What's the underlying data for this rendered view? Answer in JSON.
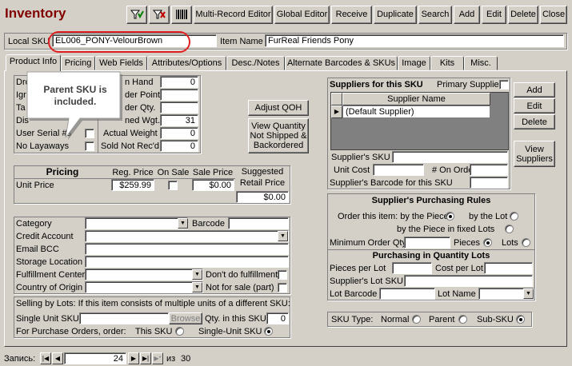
{
  "window": {
    "title": "Inventory"
  },
  "toolbar": {
    "multi_record_editor": "Multi-Record Editor",
    "global_editor": "Global Editor",
    "receive": "Receive",
    "duplicate": "Duplicate",
    "search": "Search",
    "add": "Add",
    "edit": "Edit",
    "delete": "Delete",
    "close": "Close"
  },
  "header": {
    "local_sku_label": "Local SKU",
    "local_sku": "EL006_PONY-VelourBrown",
    "item_name_label": "Item Name",
    "item_name": "FurReal Friends Pony"
  },
  "tabs": [
    "Product Info",
    "Pricing",
    "Web Fields",
    "Attributes/Options",
    "Desc./Notes",
    "Alternate Barcodes & SKUs",
    "Image",
    "Kits",
    "Misc."
  ],
  "callout": {
    "text": "Parent SKU is included."
  },
  "product": {
    "drop_label": "Dro",
    "ign_label": "Igr",
    "tax_label": "Ta",
    "dis_label": "Dis",
    "user_serial_label": "User Serial #s",
    "no_layaways_label": "No Layaways",
    "on_hand_label": "n Hand",
    "on_hand": "0",
    "reorder_point_label": "der Point",
    "reorder_qty_label": "der Qty.",
    "weight_label": "ned Wgt.",
    "weight": "31",
    "actual_weight_label": "Actual Weight",
    "actual_weight": "0",
    "sold_not_recd_label": "Sold Not Rec'd",
    "sold_not_recd": "0",
    "adjust_qoh": "Adjust QOH",
    "view_qty": "View Quantity Not Shipped & Backordered"
  },
  "pricing": {
    "header": "Pricing",
    "reg_price_label": "Reg. Price",
    "on_sale_label": "On Sale",
    "sale_price_label": "Sale Price",
    "suggested_label": "Suggested Retail Price",
    "unit_price_label": "Unit Price",
    "reg_price": "$259.99",
    "sale_price": "$0.00",
    "suggested": "$0.00"
  },
  "details": {
    "category_label": "Category",
    "barcode_label": "Barcode",
    "credit_account_label": "Credit Account",
    "email_bcc_label": "Email BCC",
    "storage_location_label": "Storage Location",
    "fulfillment_center_label": "Fulfillment Center",
    "dont_fulfill_label": "Don't do fulfillment",
    "country_label": "Country of Origin",
    "not_for_sale_label": "Not for sale (part)"
  },
  "lots": {
    "note": "Selling by Lots: If this item consists of multiple units of a different SKU:",
    "single_unit_sku_label": "Single Unit SKU",
    "browse": "Browse",
    "qty_in_sku_label": "Qty. in this SKU",
    "qty_in_sku": "0",
    "purchase_orders_label": "For Purchase Orders, order:",
    "this_sku_label": "This SKU",
    "single_unit_label": "Single-Unit SKU"
  },
  "suppliers": {
    "title": "Suppliers for this SKU",
    "primary_supplier_label": "Primary Supplier",
    "column": "Supplier Name",
    "rows": [
      "(Default Supplier)"
    ],
    "supplier_sku_label": "Supplier's SKU",
    "unit_cost_label": "Unit Cost",
    "on_order_label": "# On Order",
    "barcode_label": "Supplier's Barcode for this SKU",
    "add": "Add",
    "edit": "Edit",
    "delete": "Delete",
    "view": "View Suppliers"
  },
  "purchasing": {
    "title": "Supplier's Purchasing Rules",
    "order_item_label": "Order this item: by the Piece",
    "by_lot_label": "by the Lot",
    "fixed_lots_label": "by the Piece in fixed Lots",
    "min_order_label": "Minimum Order Qty.",
    "pieces_label": "Pieces",
    "lots_label": "Lots",
    "qty_lots_title": "Purchasing in Quantity Lots",
    "pieces_per_lot_label": "Pieces per Lot",
    "cost_per_lot_label": "Cost per Lot",
    "lot_sku_label": "Supplier's Lot SKU",
    "lot_barcode_label": "Lot Barcode",
    "lot_name_label": "Lot Name"
  },
  "sku_type": {
    "label": "SKU Type:",
    "normal": "Normal",
    "parent": "Parent",
    "sub": "Sub-SKU"
  },
  "nav": {
    "record_label": "Запись:",
    "record": "24",
    "of_label": "из",
    "total": "30"
  }
}
